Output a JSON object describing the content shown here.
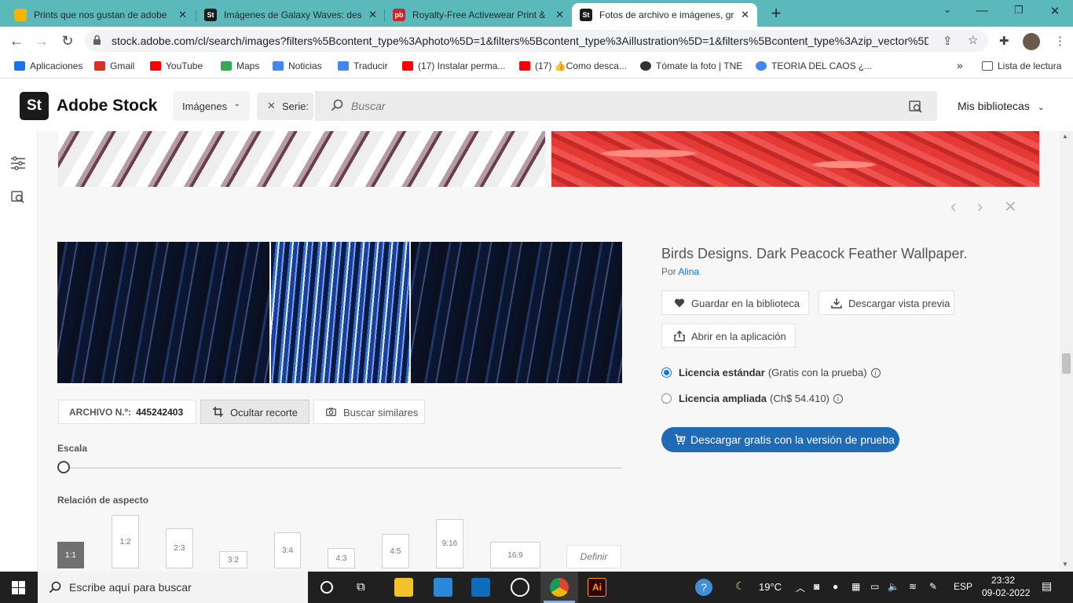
{
  "browser": {
    "tabs": [
      {
        "title": "Prints que nos gustan de adobe",
        "favicon_color": "#f4b400",
        "favicon_glyph": ""
      },
      {
        "title": "Imágenes de Galaxy Waves: des",
        "favicon_color": "#1a1a1a",
        "favicon_glyph": "St"
      },
      {
        "title": "Royalty-Free Activewear Print &",
        "favicon_color": "#c62828",
        "favicon_glyph": "pb"
      },
      {
        "title": "Fotos de archivo e imágenes, gr",
        "favicon_color": "#1a1a1a",
        "favicon_glyph": "St"
      }
    ],
    "new_tab_glyph": "+",
    "url": "stock.adobe.com/cl/search/images?filters%5Bcontent_type%3Aphoto%5D=1&filters%5Bcontent_type%3Aillustration%5D=1&filters%5Bcontent_type%3Azip_vector%5D...",
    "bookmarks": [
      {
        "label": "Aplicaciones",
        "color": "#1a73e8"
      },
      {
        "label": "Gmail",
        "color": "#d93025"
      },
      {
        "label": "YouTube",
        "color": "#ff0000"
      },
      {
        "label": "Maps",
        "color": "#34a853"
      },
      {
        "label": "Noticias",
        "color": "#4285f4"
      },
      {
        "label": "Traducir",
        "color": "#4285f4"
      },
      {
        "label": "(17) Instalar perma...",
        "color": "#ff0000"
      },
      {
        "label": "(17) 👍Como desca...",
        "color": "#ff0000"
      },
      {
        "label": "Tómate la foto | TNE",
        "color": "#333333"
      },
      {
        "label": "TEORIA DEL CAOS ¿...",
        "color": "#4285f4"
      }
    ],
    "more_bookmarks": "»",
    "reading_list": "Lista de lectura"
  },
  "stock": {
    "logo_badge": "St",
    "logo_text": "Adobe Stock",
    "content_type": "Imágenes",
    "series_chip": "Serie:",
    "search_placeholder": "Buscar",
    "libraries": "Mis bibliotecas"
  },
  "detail": {
    "title": "Birds Designs. Dark Peacock Feather Wallpaper.",
    "by_prefix": "Por",
    "author": "Alina",
    "save_label": "Guardar en la biblioteca",
    "preview_label": "Descargar vista previa",
    "open_app_label": "Abrir en la aplicación",
    "licenses": [
      {
        "name": "Licencia estándar",
        "detail": "(Gratis con la prueba)",
        "selected": true
      },
      {
        "name": "Licencia ampliada",
        "detail": "(Ch$ 54.410)",
        "selected": false
      }
    ],
    "cta": "Descargar gratis con la versión de prueba",
    "archive_label": "ARCHIVO N.º:",
    "archive_number": "445242403",
    "hide_crop": "Ocultar recorte",
    "find_similar": "Buscar similares",
    "scale_label": "Escala",
    "aspect_label": "Relación de aspecto",
    "ratios": [
      "1:1",
      "1:2",
      "2:3",
      "3:2",
      "3:4",
      "4:3",
      "4:5",
      "9:16",
      "16:9",
      "Definir"
    ],
    "selected_ratio": "1:1"
  },
  "taskbar": {
    "search_placeholder": "Escribe aquí para buscar",
    "temperature": "19°C",
    "language": "ESP",
    "time": "23:32",
    "date": "09-02-2022"
  }
}
